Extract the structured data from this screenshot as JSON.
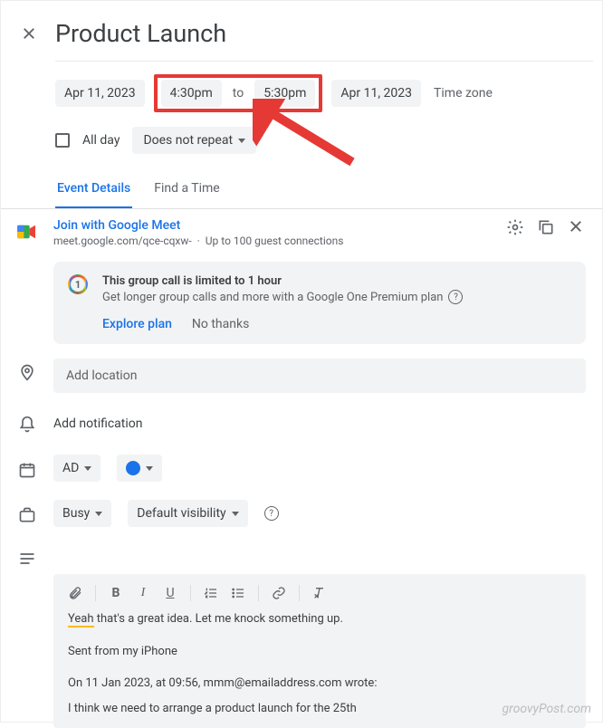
{
  "title": "Product Launch",
  "dates": {
    "start_date": "Apr 11, 2023",
    "start_time": "4:30pm",
    "to_label": "to",
    "end_time": "5:30pm",
    "end_date": "Apr 11, 2023",
    "timezone_label": "Time zone"
  },
  "allday": {
    "label": "All day",
    "checked": false
  },
  "repeat": {
    "label": "Does not repeat"
  },
  "tabs": [
    {
      "label": "Event Details",
      "active": true
    },
    {
      "label": "Find a Time",
      "active": false
    }
  ],
  "meet": {
    "join_label": "Join with Google Meet",
    "url": "meet.google.com/qce-cqxw-",
    "capacity": "Up to 100 guest connections"
  },
  "banner": {
    "title": "This group call is limited to 1 hour",
    "subtitle": "Get longer group calls and more with a Google One Premium plan",
    "primary": "Explore plan",
    "secondary": "No thanks"
  },
  "location": {
    "placeholder": "Add location"
  },
  "notification": {
    "label": "Add notification"
  },
  "calendar": {
    "owner_initials": "AD"
  },
  "availability": {
    "status": "Busy",
    "visibility": "Default visibility"
  },
  "description": {
    "line1_underlined": "Yeah",
    "line1_rest": " that's a great idea. Let me knock something up.",
    "line2": "Sent from my iPhone",
    "line3": "On 11 Jan 2023, at 09:56, mmm@emailaddress.com wrote:",
    "line4": "I think we need to arrange a product launch for the 25th"
  },
  "watermark": "groovyPost.com"
}
